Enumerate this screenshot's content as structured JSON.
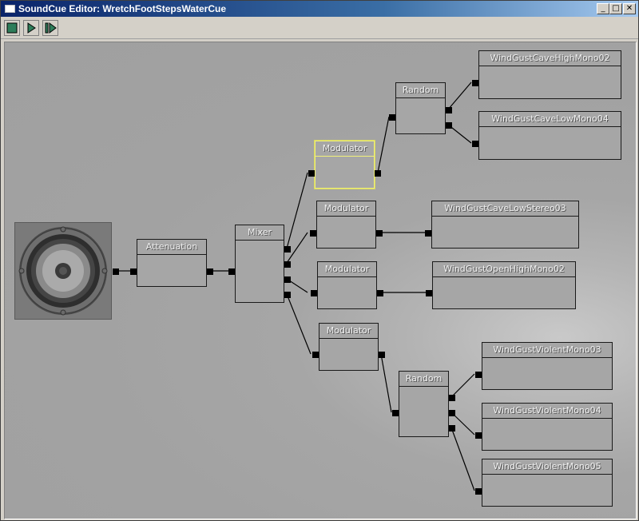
{
  "window": {
    "title": "SoundCue Editor: WretchFootStepsWaterCue",
    "controls": {
      "minimize": "_",
      "maximize": "□",
      "close": "✕"
    }
  },
  "toolbar": {
    "buttons": [
      {
        "name": "stop-button",
        "icon": "stop-square-icon"
      },
      {
        "name": "play-button",
        "icon": "play-triangle-icon"
      },
      {
        "name": "play-node-button",
        "icon": "play-bar-triangle-icon"
      }
    ]
  },
  "graph": {
    "output": {
      "icon": "speaker-icon"
    },
    "nodes": {
      "attenuation": "Attenuation",
      "mixer": "Mixer",
      "modulator1": "Modulator",
      "modulator2": "Modulator",
      "modulator3": "Modulator",
      "modulator4": "Modulator",
      "random1": "Random",
      "random2": "Random",
      "wave1": "WindGustCaveHighMono02",
      "wave2": "WindGustCaveLowMono04",
      "wave3": "WindGustCaveLowStereo03",
      "wave4": "WindGustOpenHighMono02",
      "wave5": "WindGustViolentMono03",
      "wave6": "WindGustViolentMono04",
      "wave7": "WindGustViolentMono05"
    },
    "selected_node": "modulator1",
    "colors": {
      "canvas": "#a4a4a4",
      "node": "#a6a6a6",
      "selected": "#f0f07a",
      "wire": "#000000"
    }
  }
}
